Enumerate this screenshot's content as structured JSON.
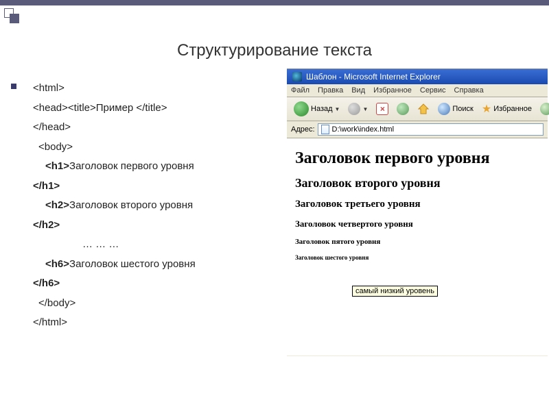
{
  "slide": {
    "title": "Структурирование текста"
  },
  "code": {
    "l1": "<html>",
    "l2_a": "<head><title>",
    "l2_b": "Пример",
    "l2_c": "      </title>",
    "l3": "</head>",
    "l4": "<body>",
    "l5_tag_open": "<h1>",
    "l5_text": "Заголовок первого уровня",
    "l5_tag_close": "</h1>",
    "l6_tag_open": "<h2>",
    "l6_text": "Заголовок второго уровня",
    "l6_tag_close": "</h2>",
    "l7": "… … …",
    "l8_tag_open": "<h6>",
    "l8_text": "Заголовок шестого уровня",
    "l8_tag_close": "</h6>",
    "l9": "</body>",
    "l10": "</html>"
  },
  "browser": {
    "title": "Шаблон - Microsoft Internet Explorer",
    "menu": {
      "file": "Файл",
      "edit": "Правка",
      "view": "Вид",
      "favorites": "Избранное",
      "tools": "Сервис",
      "help": "Справка"
    },
    "toolbar": {
      "back": "Назад",
      "search": "Поиск",
      "favorites": "Избранное"
    },
    "address_label": "Адрес:",
    "address_value": "D:\\work\\index.html",
    "content": {
      "h1": "Заголовок первого уровня",
      "h2": "Заголовок второго уровня",
      "h3": "Заголовок третьего уровня",
      "h4": "Заголовок четвертого уровня",
      "h5": "Заголовок пятого уровня",
      "h6": "Заголовок шестого уровня"
    },
    "tooltip": "самый низкий уровень"
  }
}
